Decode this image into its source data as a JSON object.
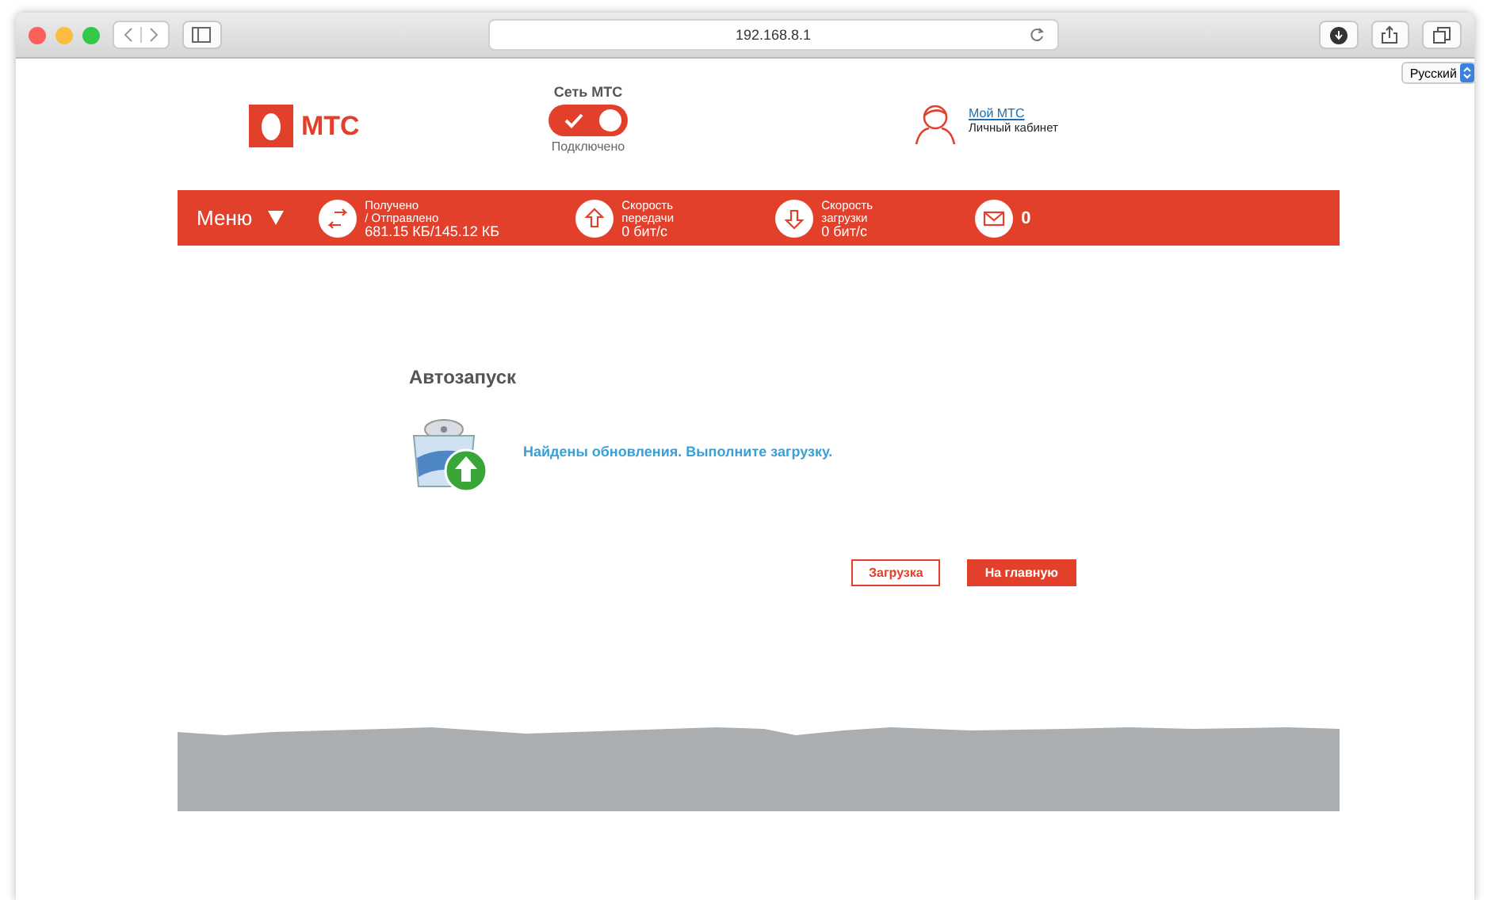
{
  "browser": {
    "url": "192.168.8.1"
  },
  "language": {
    "value": "Русский"
  },
  "logo": {
    "text": "МТС"
  },
  "network": {
    "title": "Сеть МТС",
    "on": true,
    "status": "Подключено"
  },
  "account": {
    "link": "Мой МТС",
    "subtitle": "Личный кабинет"
  },
  "menu": {
    "label": "Меню"
  },
  "stats": [
    {
      "kind": "traffic",
      "label": "Получено / Отправлено",
      "value": "681.15 КБ/145.12 КБ"
    },
    {
      "kind": "upload",
      "label": "Скорость передачи",
      "value": "0 бит/с"
    },
    {
      "kind": "download",
      "label": "Скорость загрузки",
      "value": "0 бит/с"
    },
    {
      "kind": "messages",
      "value": "0"
    }
  ],
  "heading": "Автозапуск",
  "message": "Найдены обновления. Выполните загрузку.",
  "buttons": [
    {
      "label": "Загрузка",
      "kind": "secondary"
    },
    {
      "label": "На главную",
      "kind": "primary"
    }
  ]
}
